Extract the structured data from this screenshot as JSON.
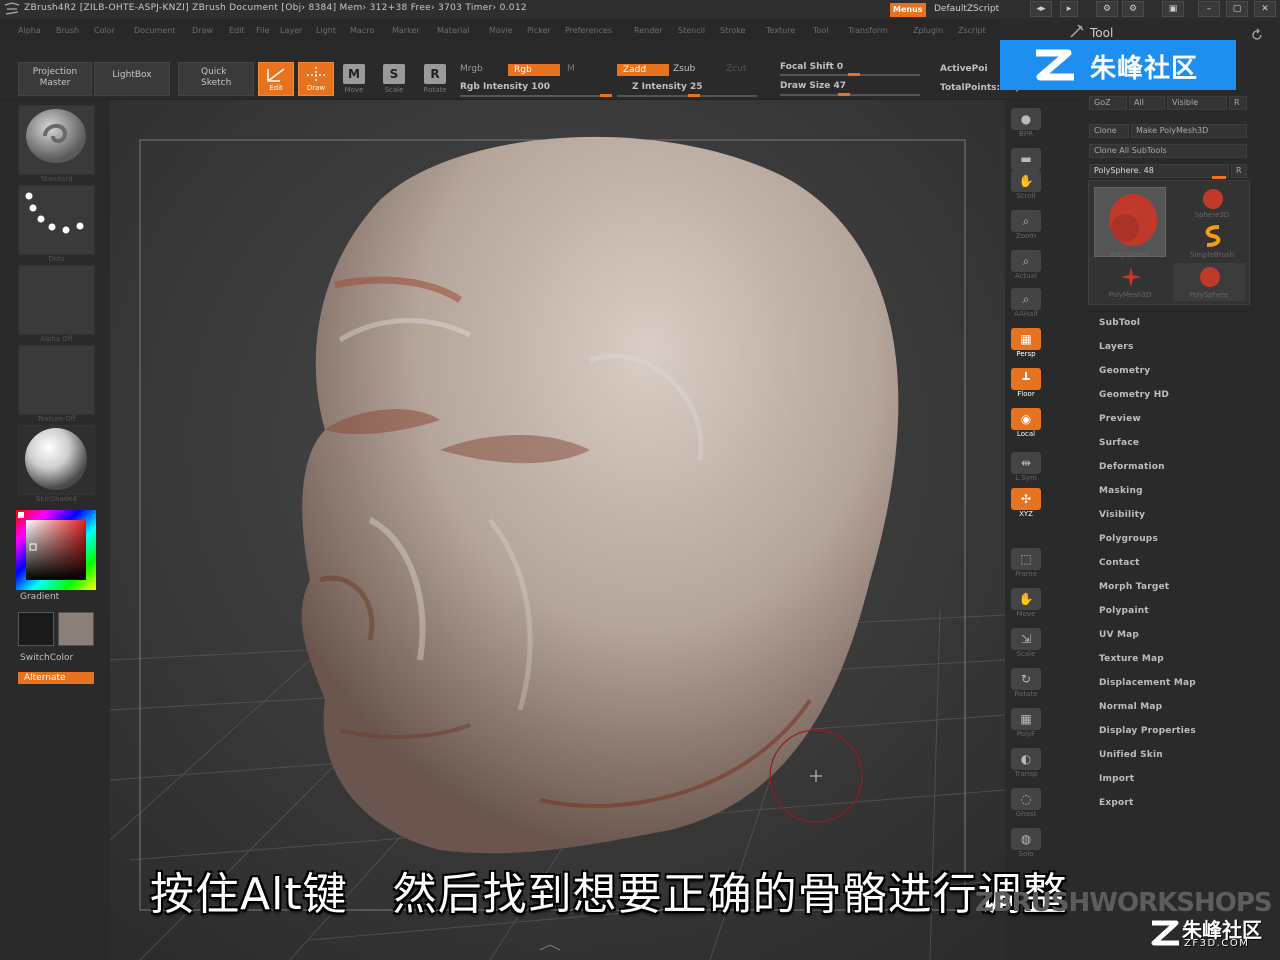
{
  "titlebar": {
    "text": "ZBrush4R2 [ZILB-OHTE-ASPJ-KNZI]    ZBrush Document     [Obj› 8384] Mem› 312+38 Free› 3703 Timer› 0.012",
    "menus_label": "Menus",
    "script_label": "DefaultZScript"
  },
  "menubar": {
    "items": [
      "Alpha",
      "Brush",
      "Color",
      "Document",
      "Draw",
      "Edit",
      "File",
      "Layer",
      "Light",
      "Macro",
      "Marker",
      "Material",
      "Movie",
      "Picker",
      "Preferences",
      "Render",
      "Stencil",
      "Stroke",
      "Texture",
      "Tool",
      "Transform",
      "Zplugin",
      "Zscript"
    ]
  },
  "toolbar": {
    "projection_master": "Projection\nMaster",
    "lightbox": "LightBox",
    "quick_sketch": "Quick\nSketch",
    "edit": "Edit",
    "draw": "Draw",
    "move": "Move",
    "scale": "Scale",
    "rotate": "Rotate",
    "mrgb": "Mrgb",
    "rgb": "Rgb",
    "m": "M",
    "rgb_intensity": "Rgb Intensity 100",
    "zadd": "Zadd",
    "zsub": "Zsub",
    "zcut": "Zcut",
    "z_intensity": "Z Intensity 25",
    "focal_shift": "Focal Shift 0",
    "draw_size": "Draw Size 47",
    "active_points": "ActivePoi",
    "total_points": "TotalPoints: 10,03"
  },
  "leftshelf": {
    "brush_label": "Standard",
    "stroke_label": "Dots",
    "alpha_label": "Alpha Off",
    "texture_label": "Texture Off",
    "material_label": "SkinShade4",
    "gradient_label": "Gradient",
    "switchcolor_label": "SwitchColor",
    "alternate_label": "Alternate",
    "colors": {
      "main": "#1a1a1a",
      "secondary": "#8a8078",
      "accent": "#e8731f"
    }
  },
  "rightshelf": {
    "items": [
      {
        "label": "BPR",
        "icon": "sphere-icon",
        "on": false
      },
      {
        "label": "SPix",
        "icon": "spix-icon",
        "on": false
      },
      {
        "label": "Scroll",
        "icon": "hand-icon",
        "on": false
      },
      {
        "label": "Zoom",
        "icon": "zoom-icon",
        "on": false
      },
      {
        "label": "Actual",
        "icon": "magnifier-icon",
        "on": false
      },
      {
        "label": "AAHalf",
        "icon": "magnifier-icon",
        "on": false
      },
      {
        "label": "Persp",
        "icon": "grid-icon",
        "on": true
      },
      {
        "label": "Floor",
        "icon": "floor-icon",
        "on": true
      },
      {
        "label": "Local",
        "icon": "local-icon",
        "on": true
      },
      {
        "label": "L.Sym",
        "icon": "sym-icon",
        "on": false
      },
      {
        "label": "XYZ",
        "icon": "xyz-icon",
        "on": true
      },
      {
        "label": "Frame",
        "icon": "frame-icon",
        "on": false
      },
      {
        "label": "Move",
        "icon": "hand-icon",
        "on": false
      },
      {
        "label": "Scale",
        "icon": "scale-icon",
        "on": false
      },
      {
        "label": "Rotate",
        "icon": "rotate-icon",
        "on": false
      },
      {
        "label": "PolyF",
        "icon": "polyf-icon",
        "on": false
      },
      {
        "label": "Transp",
        "icon": "transp-icon",
        "on": false
      },
      {
        "label": "Ghost",
        "icon": "ghost-icon",
        "on": false
      },
      {
        "label": "Solo",
        "icon": "solo-icon",
        "on": false
      }
    ]
  },
  "toolpanel": {
    "title": "Tool",
    "goz": "GoZ",
    "all": "All",
    "visible": "Visible",
    "r": "R",
    "clone": "Clone",
    "make_polymesh": "Make PolyMesh3D",
    "clone_all": "Clone All SubTools",
    "polysphere": "PolySphere. 48",
    "tools": [
      "PolySphere",
      "Sphere3D",
      "SimpleBrush",
      "PolyMesh3D",
      "PolySphere"
    ],
    "sections": [
      "SubTool",
      "Layers",
      "Geometry",
      "Geometry HD",
      "Preview",
      "Surface",
      "Deformation",
      "Masking",
      "Visibility",
      "Polygroups",
      "Contact",
      "Morph Target",
      "Polypaint",
      "UV Map",
      "Texture Map",
      "Displacement Map",
      "Normal Map",
      "Display Properties",
      "Unified Skin",
      "Import",
      "Export"
    ]
  },
  "watermark": {
    "text": "朱峰社区"
  },
  "subtitle": {
    "text": "按住Alt键　然后找到想要正确的骨骼进行调整"
  },
  "branding": {
    "workshops": "ZBRUSHWORKSHOPS",
    "cn": "朱峰社区",
    "url": "ZF3D.COM"
  }
}
